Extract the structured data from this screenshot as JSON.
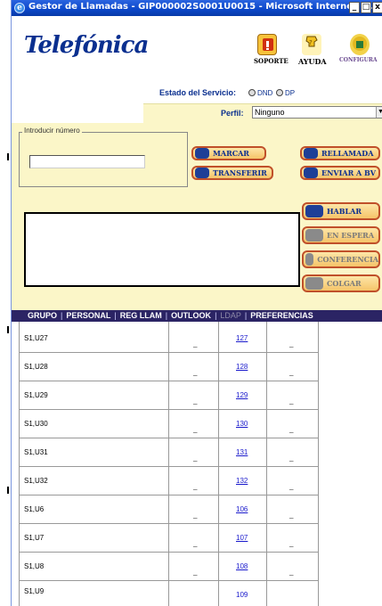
{
  "window": {
    "title": "Gestor de Llamadas - GIP000002S0001U0015 - Microsoft Internet E...",
    "controls": [
      "_",
      "□",
      "x"
    ]
  },
  "header": {
    "logo": "Telefónica",
    "soporte": "SOPORTE",
    "ayuda": "AYUDA",
    "configurar": "CONFIGURA"
  },
  "status": {
    "label": "Estado del Servicio:",
    "dnd": "DND",
    "dp": "DP"
  },
  "perfil": {
    "label": "Perfil:",
    "value": "Ninguno"
  },
  "dial": {
    "legend": "Introducir número",
    "value": ""
  },
  "buttons": {
    "marcar": "MARCAR",
    "rellamada": "RELLAMADA",
    "transferir": "TRANSFERIR",
    "enviar_bv": "ENVIAR A BV",
    "hablar": "HABLAR",
    "en_espera": "EN ESPERA",
    "conferencia": "CONFERENCIA",
    "colgar": "COLGAR"
  },
  "menu": {
    "grupo": "GRUPO",
    "personal": "PERSONAL",
    "reg_llam": "REG LLAM",
    "outlook": "OUTLOOK",
    "ldap": "LDAP",
    "preferencias": "PREFERENCIAS"
  },
  "rows": [
    {
      "name": "S1,U27",
      "a": "_",
      "ext": "127",
      "b": "_"
    },
    {
      "name": "S1,U28",
      "a": "_",
      "ext": "128",
      "b": "_"
    },
    {
      "name": "S1,U29",
      "a": "_",
      "ext": "129",
      "b": "_"
    },
    {
      "name": "S1,U30",
      "a": "_",
      "ext": "130",
      "b": "_"
    },
    {
      "name": "S1,U31",
      "a": "_",
      "ext": "131",
      "b": "_"
    },
    {
      "name": "S1,U32",
      "a": "_",
      "ext": "132",
      "b": "_"
    },
    {
      "name": "S1,U6",
      "a": "_",
      "ext": "106",
      "b": "_"
    },
    {
      "name": "S1,U7",
      "a": "_",
      "ext": "107",
      "b": "_"
    },
    {
      "name": "S1,U8",
      "a": "_",
      "ext": "108",
      "b": "_"
    },
    {
      "name": "S1,U9",
      "a": "",
      "ext": "109",
      "b": ""
    }
  ],
  "colors": {
    "titlebar": "#0b46c8",
    "panel": "#fbf6c8",
    "menubar": "#2b2464",
    "button_border": "#c0502a",
    "brand": "#0a2f8f"
  }
}
